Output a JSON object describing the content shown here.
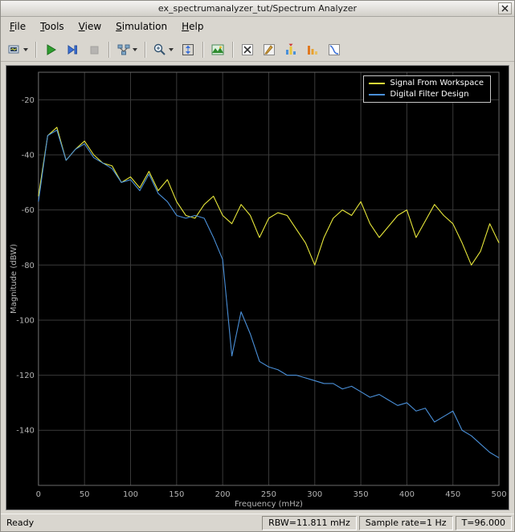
{
  "window": {
    "title": "ex_spectrumanalyzer_tut/Spectrum Analyzer"
  },
  "menubar": {
    "items": [
      {
        "label": "File"
      },
      {
        "label": "Tools"
      },
      {
        "label": "View"
      },
      {
        "label": "Simulation"
      },
      {
        "label": "Help"
      }
    ]
  },
  "toolbar": {
    "icons": [
      "configuration-dropdown",
      "run",
      "step-forward",
      "stop",
      "simulation-options-dropdown",
      "zoom-dropdown",
      "span-full-view",
      "spectrum-settings",
      "cursor-measurements",
      "signal-statistics",
      "peak-finder",
      "distortion-measurements",
      "ccdf-measurements"
    ]
  },
  "statusbar": {
    "ready": "Ready",
    "rbw": "RBW=11.811 mHz",
    "sample_rate": "Sample rate=1 Hz",
    "time": "T=96.000"
  },
  "chart_data": {
    "type": "line",
    "title": "",
    "xlabel": "Frequency (mHz)",
    "ylabel": "Magnitude (dBW)",
    "xlim": [
      0,
      500
    ],
    "ylim": [
      -160,
      -10
    ],
    "xticks": [
      0,
      50,
      100,
      150,
      200,
      250,
      300,
      350,
      400,
      450,
      500
    ],
    "yticks": [
      -20,
      -40,
      -60,
      -80,
      -100,
      -120,
      -140
    ],
    "grid": true,
    "legend_position": "top-right",
    "background": "#000000",
    "grid_color": "#3a3a3a",
    "x": [
      0,
      10,
      20,
      30,
      40,
      50,
      60,
      70,
      80,
      90,
      100,
      110,
      120,
      130,
      140,
      150,
      160,
      170,
      180,
      190,
      200,
      210,
      220,
      230,
      240,
      250,
      260,
      270,
      280,
      290,
      300,
      310,
      320,
      330,
      340,
      350,
      360,
      370,
      380,
      390,
      400,
      410,
      420,
      430,
      440,
      450,
      460,
      470,
      480,
      490,
      500
    ],
    "series": [
      {
        "name": "Signal From Workspace",
        "color": "#e8e83a",
        "values": [
          -55,
          -33,
          -30,
          -42,
          -38,
          -35,
          -40,
          -43,
          -44,
          -50,
          -48,
          -52,
          -46,
          -53,
          -49,
          -57,
          -62,
          -63,
          -58,
          -55,
          -62,
          -65,
          -58,
          -62,
          -70,
          -63,
          -61,
          -62,
          -67,
          -72,
          -80,
          -70,
          -63,
          -60,
          -62,
          -57,
          -65,
          -70,
          -66,
          -62,
          -60,
          -70,
          -64,
          -58,
          -62,
          -65,
          -72,
          -80,
          -75,
          -65,
          -72
        ]
      },
      {
        "name": "Digital Filter Design",
        "color": "#4a90d9",
        "values": [
          -57,
          -33,
          -31,
          -42,
          -38,
          -36,
          -41,
          -43,
          -45,
          -50,
          -49,
          -53,
          -47,
          -54,
          -57,
          -62,
          -63,
          -62,
          -63,
          -70,
          -78,
          -113,
          -97,
          -105,
          -115,
          -117,
          -118,
          -120,
          -120,
          -121,
          -122,
          -123,
          -123,
          -125,
          -124,
          -126,
          -128,
          -127,
          -129,
          -131,
          -130,
          -133,
          -132,
          -137,
          -135,
          -133,
          -140,
          -142,
          -145,
          -148,
          -150
        ]
      }
    ]
  }
}
